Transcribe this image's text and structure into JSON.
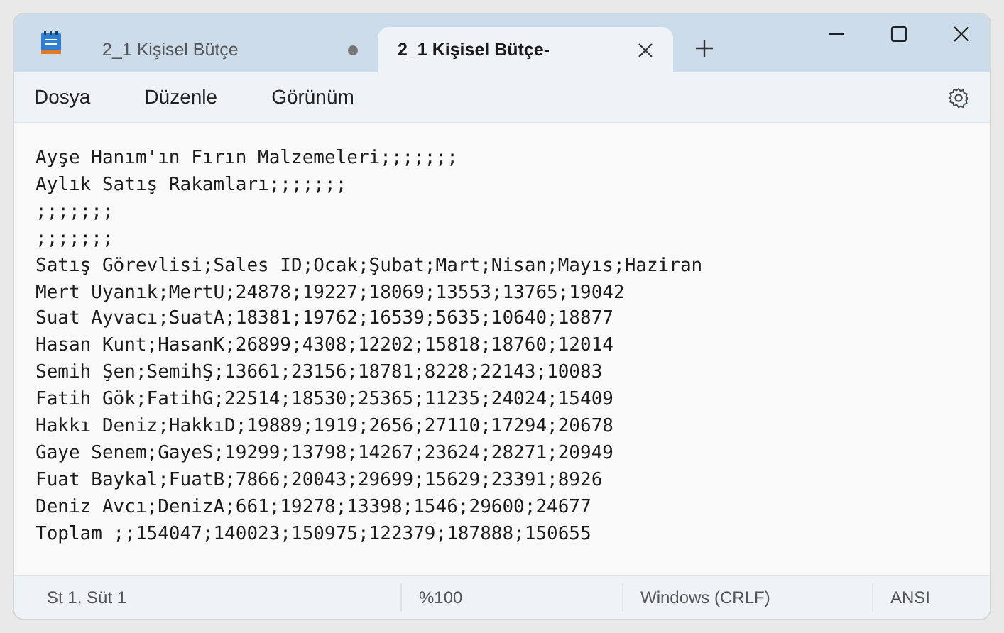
{
  "window": {
    "tabs": [
      {
        "label": "2_1 Kişisel Bütçe",
        "selected": false,
        "modified": true
      },
      {
        "label": "2_1 Kişisel Bütçe-",
        "selected": true,
        "modified": false
      }
    ]
  },
  "menu": [
    "Dosya",
    "Düzenle",
    "Görünüm"
  ],
  "editor": {
    "lines": [
      "Ayşe Hanım'ın Fırın Malzemeleri;;;;;;;",
      "Aylık Satış Rakamları;;;;;;;",
      ";;;;;;;",
      ";;;;;;;",
      "Satış Görevlisi;Sales ID;Ocak;Şubat;Mart;Nisan;Mayıs;Haziran",
      "Mert Uyanık;MertU;24878;19227;18069;13553;13765;19042",
      "Suat Ayvacı;SuatA;18381;19762;16539;5635;10640;18877",
      "Hasan Kunt;HasanK;26899;4308;12202;15818;18760;12014",
      "Semih Şen;SemihŞ;13661;23156;18781;8228;22143;10083",
      "Fatih Gök;FatihG;22514;18530;25365;11235;24024;15409",
      "Hakkı Deniz;HakkıD;19889;1919;2656;27110;17294;20678",
      "Gaye Senem;GayeS;19299;13798;14267;23624;28271;20949",
      "Fuat Baykal;FuatB;7866;20043;29699;15629;23391;8926",
      "Deniz Avcı;DenizA;661;19278;13398;1546;29600;24677",
      "Toplam ;;154047;140023;150975;122379;187888;150655"
    ]
  },
  "status_bar": {
    "position": "St 1, Süt 1",
    "zoom": "%100",
    "line_ending": "Windows (CRLF)",
    "encoding": "ANSI"
  }
}
